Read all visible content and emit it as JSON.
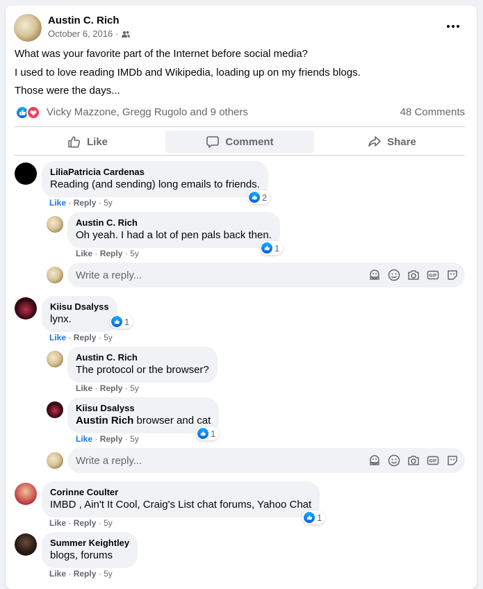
{
  "post": {
    "author": "Austin C. Rich",
    "date": "October 6, 2016",
    "date_separator": "·",
    "privacy_icon": "friends-icon",
    "lines": [
      "What was your favorite part of the Internet before social media?",
      "I used to love reading IMDb and Wikipedia, loading up on my friends blogs.",
      "Those were the days..."
    ],
    "reactions_text": "Vicky Mazzone, Gregg Rugolo and 9 others",
    "comments_count": "48 Comments"
  },
  "buttons": {
    "like": "Like",
    "comment": "Comment",
    "share": "Share"
  },
  "comment_actions": {
    "like": "Like",
    "reply": "Reply",
    "sep": "·",
    "time": "5y"
  },
  "reply_placeholder": "Write a reply...",
  "comments": [
    {
      "name": "LiliaPatricia Cardenas",
      "text": "Reading (and sending) long emails to friends.",
      "likes": "2",
      "replies": [
        {
          "name": "Austin C. Rich",
          "text": "Oh yeah. I had a lot of pen pals back then.",
          "likes": "1"
        }
      ]
    },
    {
      "name": "Kiisu Dsalyss",
      "text": "lynx.",
      "likes": "1",
      "replies": [
        {
          "name": "Austin C. Rich",
          "text": "The protocol or the browser?"
        },
        {
          "name": "Kiisu Dsalyss",
          "tag": "Austin Rich",
          "text": " browser and cat",
          "likes": "1"
        }
      ]
    },
    {
      "name": "Corinne Coulter",
      "text": "IMBD , Ain't It Cool, Craig's List chat forums, Yahoo Chat",
      "likes": "1"
    },
    {
      "name": "Summer Keightley",
      "text": "blogs, forums"
    }
  ],
  "colors": {
    "accent": "#1877f2",
    "love": "#f33e58",
    "muted": "#65676b"
  }
}
